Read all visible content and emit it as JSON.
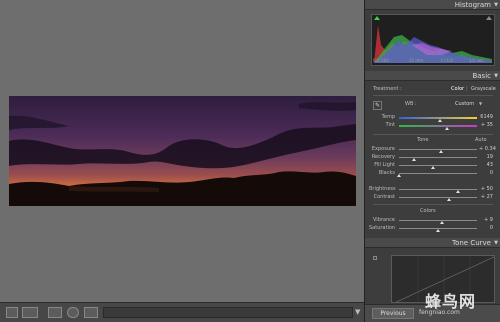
{
  "histogram": {
    "title": "Histogram",
    "info": [
      "ISO 500",
      "12 mm",
      "f / 4.0",
      "1/2 sec"
    ]
  },
  "basic": {
    "title": "Basic",
    "treatment_label": "Treatment :",
    "treatment_options": [
      "Color",
      "Grayscale"
    ],
    "treatment_selected": "Color",
    "wb_label": "WB :",
    "wb_value": "Custom",
    "temp": {
      "label": "Temp",
      "value": "6149",
      "pos": 0.52
    },
    "tint": {
      "label": "Tint",
      "value": "+ 35",
      "pos": 0.62
    },
    "tone_label": "Tone",
    "auto_label": "Auto",
    "tone_sliders": [
      {
        "label": "Exposure",
        "value": "+ 0.34",
        "pos": 0.54
      },
      {
        "label": "Recovery",
        "value": "19",
        "pos": 0.19
      },
      {
        "label": "Fill Light",
        "value": "43",
        "pos": 0.43
      },
      {
        "label": "Blacks",
        "value": "0",
        "pos": 0.0
      }
    ],
    "tone_sliders_2": [
      {
        "label": "Brightness",
        "value": "+ 50",
        "pos": 0.75
      },
      {
        "label": "Contrast",
        "value": "+ 27",
        "pos": 0.64
      }
    ],
    "colors_label": "Colors",
    "color_sliders": [
      {
        "label": "Vibrance",
        "value": "+ 9",
        "pos": 0.55
      },
      {
        "label": "Saturation",
        "value": "0",
        "pos": 0.5
      }
    ]
  },
  "tone_curve": {
    "title": "Tone Curve"
  },
  "footer": {
    "previous_label": "Previous"
  },
  "watermark": {
    "text": "蜂鸟网",
    "sub": "fengniao.com"
  }
}
